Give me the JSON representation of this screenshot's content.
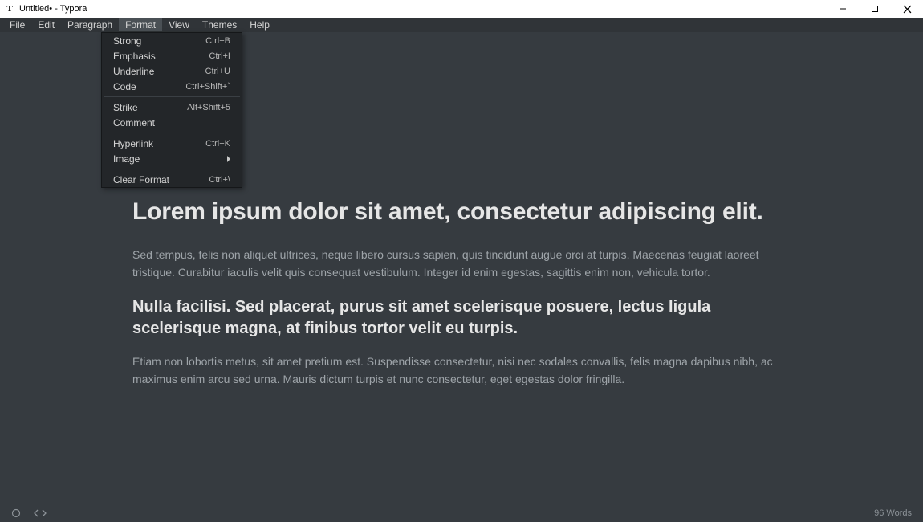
{
  "window": {
    "title": "Untitled• - Typora",
    "app_icon_letter": "T"
  },
  "menubar": {
    "items": [
      "File",
      "Edit",
      "Paragraph",
      "Format",
      "View",
      "Themes",
      "Help"
    ],
    "active_index": 3
  },
  "dropdown": {
    "groups": [
      [
        {
          "label": "Strong",
          "shortcut": "Ctrl+B"
        },
        {
          "label": "Emphasis",
          "shortcut": "Ctrl+I"
        },
        {
          "label": "Underline",
          "shortcut": "Ctrl+U"
        },
        {
          "label": "Code",
          "shortcut": "Ctrl+Shift+`"
        }
      ],
      [
        {
          "label": "Strike",
          "shortcut": "Alt+Shift+5"
        },
        {
          "label": "Comment",
          "shortcut": ""
        }
      ],
      [
        {
          "label": "Hyperlink",
          "shortcut": "Ctrl+K"
        },
        {
          "label": "Image",
          "shortcut": "",
          "submenu": true
        }
      ],
      [
        {
          "label": "Clear Format",
          "shortcut": "Ctrl+\\"
        }
      ]
    ]
  },
  "document": {
    "h1": "Lorem ipsum dolor sit amet, consectetur adipiscing elit.",
    "p1": "Sed tempus, felis non aliquet ultrices, neque libero cursus sapien, quis tincidunt augue orci at turpis. Maecenas feugiat laoreet tristique. Curabitur iaculis velit quis consequat vestibulum. Integer id enim egestas, sagittis enim non, vehicula tortor.",
    "h2": "Nulla facilisi. Sed placerat, purus sit amet scelerisque posuere, lectus ligula scelerisque magna, at finibus tortor velit eu turpis.",
    "p2": "Etiam non lobortis metus, sit amet pretium est. Suspendisse consectetur, nisi nec sodales convallis, felis magna dapibus nibh, ac maximus enim arcu sed urna. Mauris dictum turpis et nunc consectetur, eget egestas dolor fringilla."
  },
  "statusbar": {
    "word_count": "96 Words"
  }
}
